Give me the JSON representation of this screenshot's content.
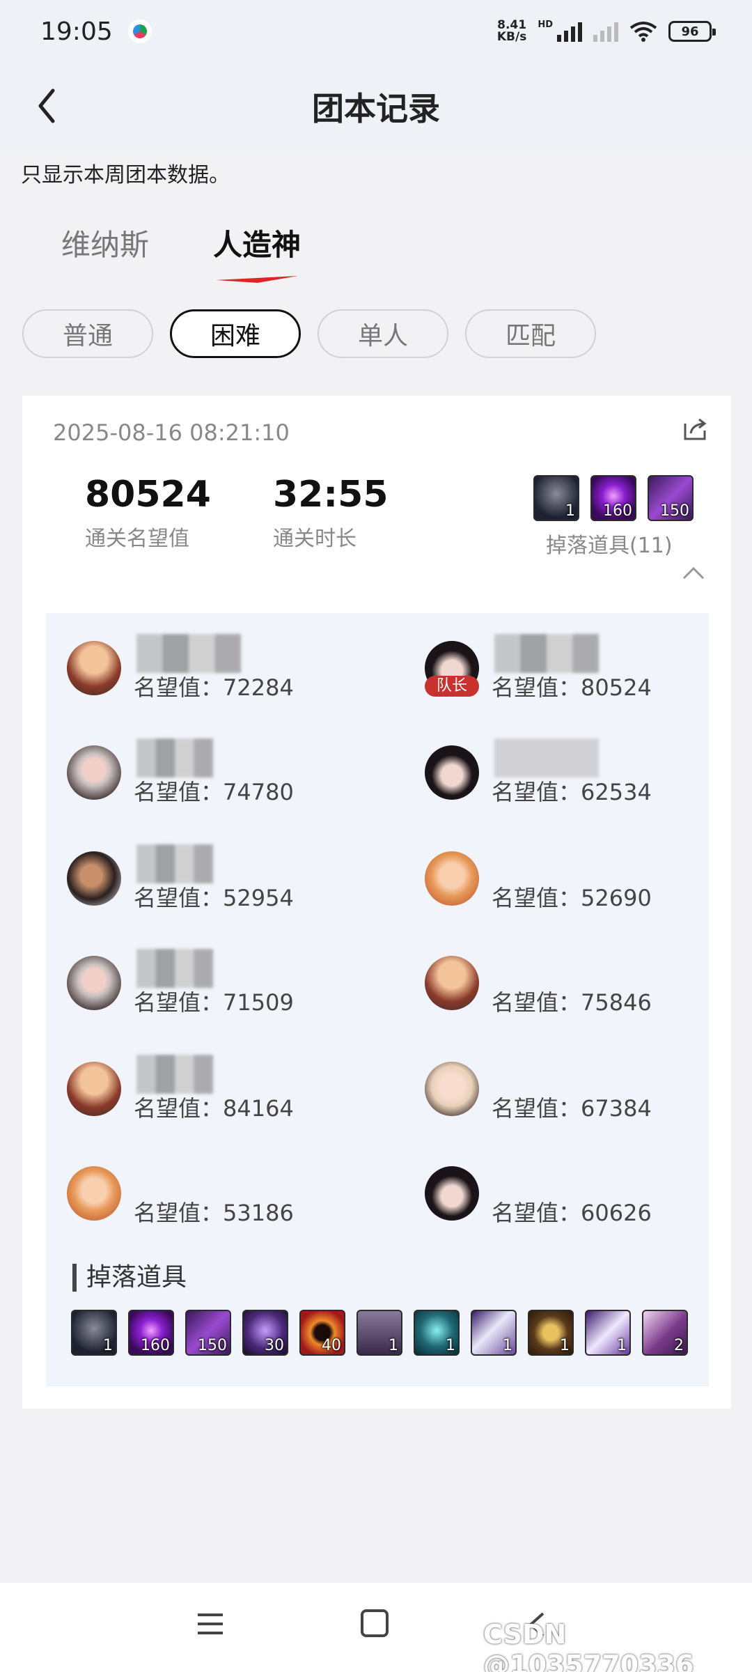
{
  "status_bar": {
    "time": "19:05",
    "net_speed_value": "8.41",
    "net_speed_unit": "KB/s",
    "hd": "HD",
    "battery": "96"
  },
  "header": {
    "title": "团本记录"
  },
  "notice": "只显示本周团本数据。",
  "tabs": [
    {
      "label": "维纳斯",
      "active": false
    },
    {
      "label": "人造神",
      "active": true
    }
  ],
  "filters": [
    {
      "label": "普通",
      "active": false
    },
    {
      "label": "困难",
      "active": true
    },
    {
      "label": "单人",
      "active": false
    },
    {
      "label": "匹配",
      "active": false
    }
  ],
  "record": {
    "timestamp": "2025-08-16 08:21:10",
    "fame": {
      "value": "80524",
      "label": "通关名望值"
    },
    "duration": {
      "value": "32:55",
      "label": "通关时长"
    },
    "drops_summary_label": "掉落道具(11)",
    "top_drops": [
      {
        "count": "1",
        "icon": "dark-cloak-item-icon"
      },
      {
        "count": "160",
        "icon": "purple-orb-item-icon"
      },
      {
        "count": "150",
        "icon": "purple-crystal-item-icon"
      }
    ],
    "members_left": [
      {
        "fame_label": "名望值：",
        "fame": "72284",
        "avatar": "goggles-gunner-avatar",
        "leader": false
      },
      {
        "fame_label": "名望值：",
        "fame": "74780",
        "avatar": "silver-hair-female-avatar",
        "leader": false
      },
      {
        "fame_label": "名望值：",
        "fame": "52954",
        "avatar": "dark-fighter-avatar",
        "leader": false
      },
      {
        "fame_label": "名望值：",
        "fame": "71509",
        "avatar": "silver-hair-female-avatar",
        "leader": false
      },
      {
        "fame_label": "名望值：",
        "fame": "84164",
        "avatar": "goggles-gunner-avatar",
        "leader": false
      },
      {
        "fame_label": "名望值：",
        "fame": "53186",
        "avatar": "blonde-gunner-avatar",
        "leader": false
      }
    ],
    "members_right": [
      {
        "fame_label": "名望值：",
        "fame": "80524",
        "avatar": "dark-hair-female-avatar",
        "leader": true,
        "leader_label": "队长"
      },
      {
        "fame_label": "名望值：",
        "fame": "62534",
        "avatar": "dark-hair-female-avatar",
        "leader": false
      },
      {
        "fame_label": "名望值：",
        "fame": "52690",
        "avatar": "blonde-gunner-avatar",
        "leader": false
      },
      {
        "fame_label": "名望值：",
        "fame": "75846",
        "avatar": "goggles-gunner-avatar",
        "leader": false
      },
      {
        "fame_label": "名望值：",
        "fame": "67384",
        "avatar": "white-hair-male-avatar",
        "leader": false
      },
      {
        "fame_label": "名望值：",
        "fame": "60626",
        "avatar": "dark-hair-female-avatar",
        "leader": false
      }
    ],
    "drops_title": "掉落道具",
    "drops": [
      {
        "count": "1",
        "icon": "dark-cloak-item-icon",
        "color": "#3a3f4a"
      },
      {
        "count": "160",
        "icon": "purple-orb-item-icon",
        "color": "#7a1fb8"
      },
      {
        "count": "150",
        "icon": "purple-crystal-item-icon",
        "color": "#5b2a8c"
      },
      {
        "count": "30",
        "icon": "violet-sphere-item-icon",
        "color": "#4a2a7a"
      },
      {
        "count": "40",
        "icon": "flame-ring-item-icon",
        "color": "#c0461a"
      },
      {
        "count": "1",
        "icon": "grey-box-item-icon",
        "color": "#5c4a6a"
      },
      {
        "count": "1",
        "icon": "cyan-gem-item-icon",
        "color": "#1f6a76"
      },
      {
        "count": "1",
        "icon": "white-feather-item-icon",
        "color": "#6a4a9a"
      },
      {
        "count": "1",
        "icon": "gold-chest-item-icon",
        "color": "#5a3a1a"
      },
      {
        "count": "1",
        "icon": "white-boot-item-icon",
        "color": "#6a3aa0"
      },
      {
        "count": "2",
        "icon": "scroll-item-icon",
        "color": "#7a3a8a"
      }
    ]
  },
  "watermark": "CSDN @1035770336"
}
